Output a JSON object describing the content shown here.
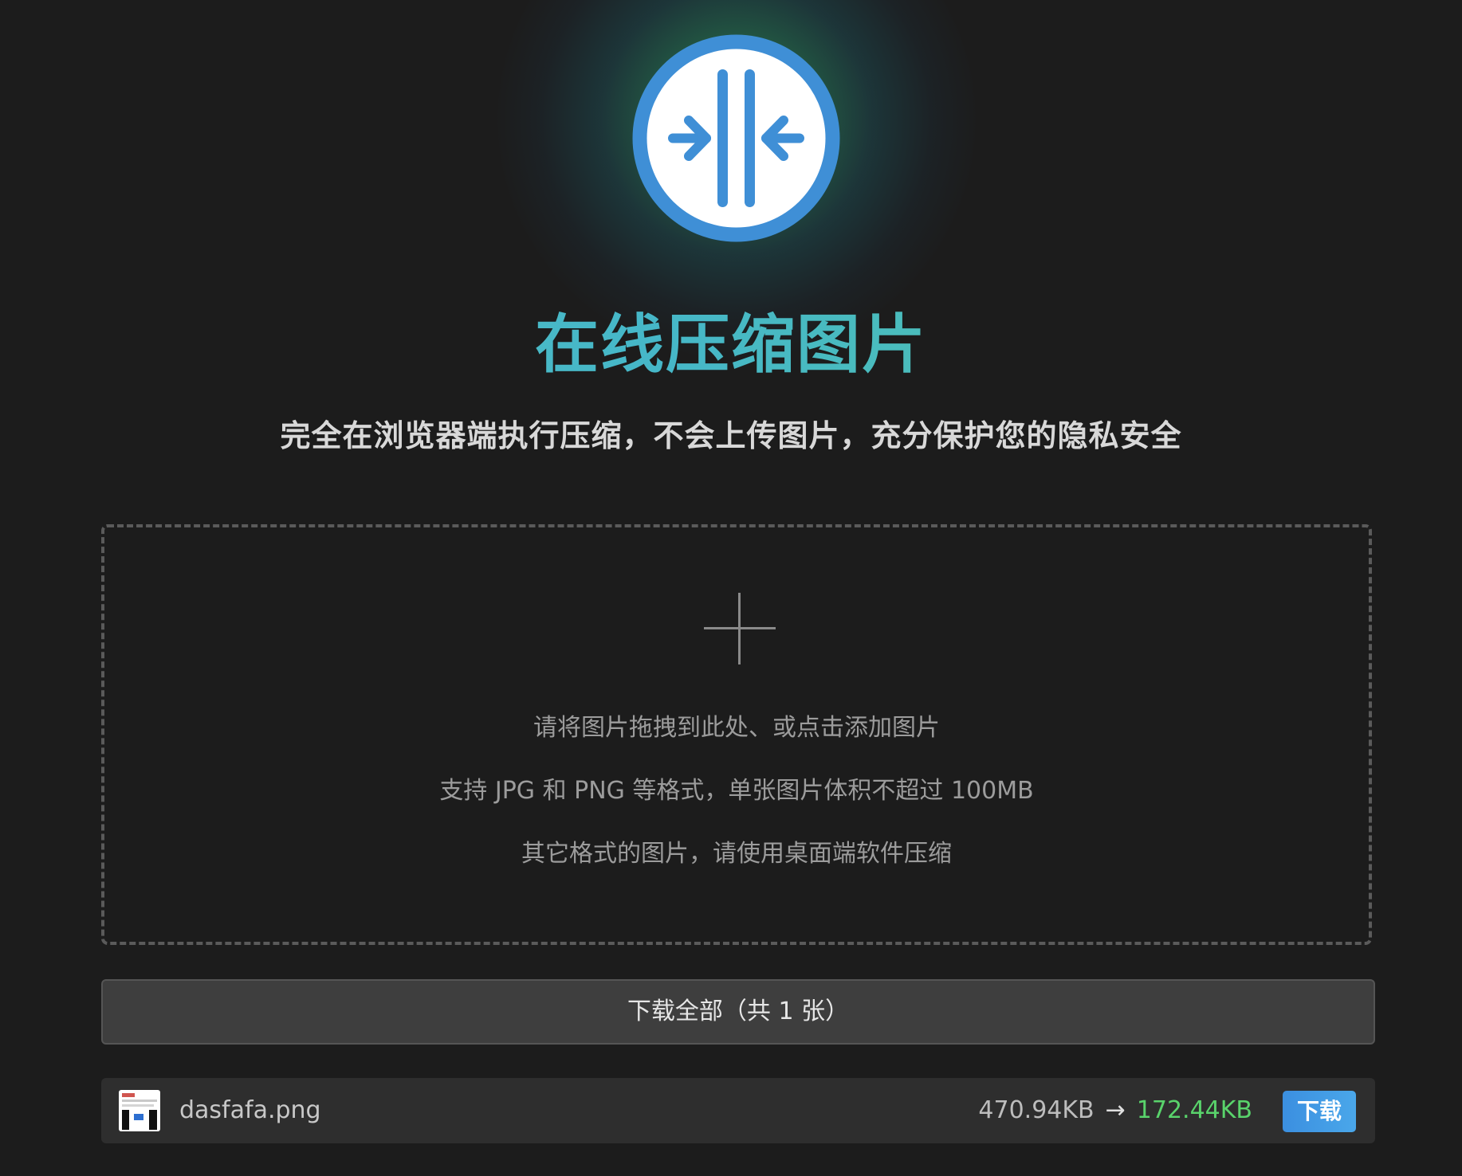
{
  "header": {
    "logo_icon": "compress-arrows-icon",
    "title": "在线压缩图片",
    "subtitle": "完全在浏览器端执行压缩，不会上传图片，充分保护您的隐私安全"
  },
  "dropzone": {
    "icon": "plus-icon",
    "line1": "请将图片拖拽到此处、或点击添加图片",
    "line2": "支持 JPG 和 PNG 等格式，单张图片体积不超过 100MB",
    "line3": "其它格式的图片，请使用桌面端软件压缩"
  },
  "download_all": {
    "label": "下载全部（共 1 张）"
  },
  "files": [
    {
      "name": "dasfafa.png",
      "original_size": "470.94KB",
      "arrow": "→",
      "compressed_size": "172.44KB",
      "download_label": "下载"
    }
  ],
  "colors": {
    "background": "#1c1c1c",
    "accent_blue": "#3b8fe0",
    "title_teal": "#4fc1c0",
    "success_green": "#59d36b"
  }
}
